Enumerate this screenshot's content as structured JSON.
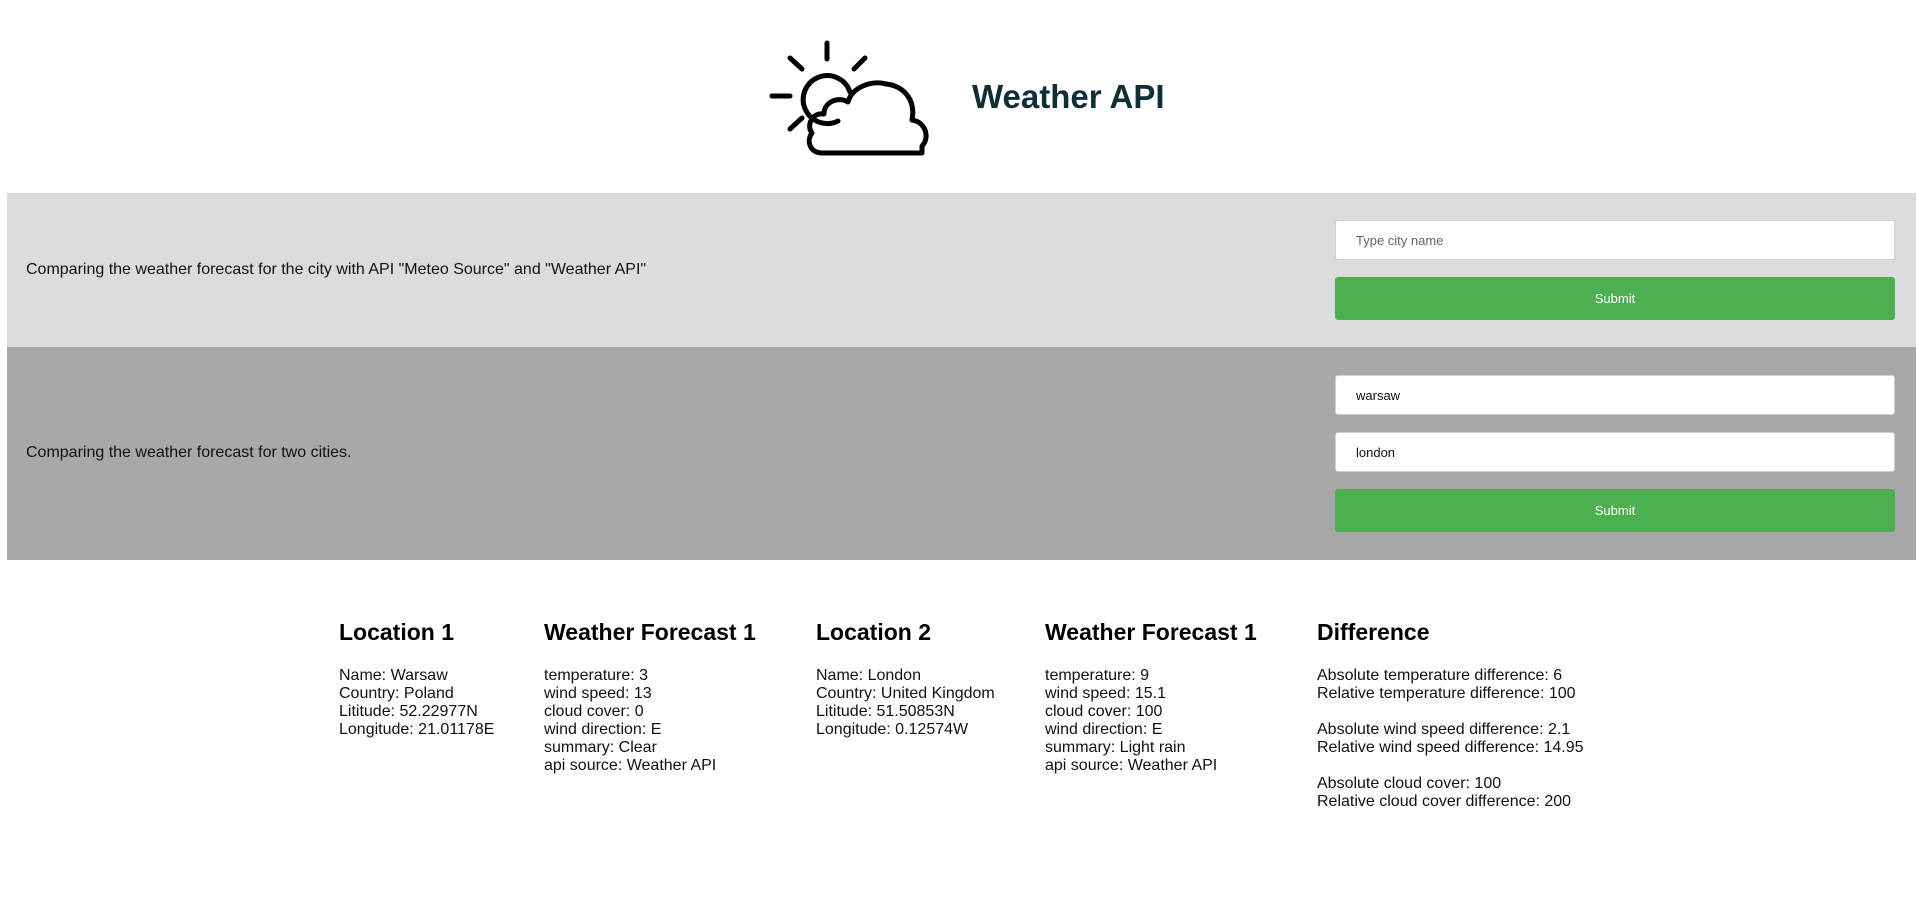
{
  "header": {
    "title": "Weather API",
    "logo_icon": "sun-cloud-icon"
  },
  "compare_api": {
    "description": "Comparing the weather forecast for the city with API \"Meteo Source\" and \"Weather API\"",
    "city_input": {
      "value": "",
      "placeholder": "Type city name"
    },
    "submit_label": "Submit"
  },
  "compare_cities": {
    "description": "Comparing the weather forecast for two cities.",
    "city1_input": {
      "value": "warsaw",
      "placeholder": ""
    },
    "city2_input": {
      "value": "london",
      "placeholder": ""
    },
    "submit_label": "Submit"
  },
  "colors": {
    "title": "#0f2e35",
    "section1_bg": "#dcdcdc",
    "section2_bg": "#a8a8a8",
    "button": "#4caf50"
  },
  "results": {
    "location1": {
      "heading": "Location 1",
      "lines": [
        "Name: Warsaw",
        "Country: Poland",
        "Lititude: 52.22977N",
        "Longitude: 21.01178E"
      ]
    },
    "forecast1": {
      "heading": "Weather Forecast 1",
      "lines": [
        "temperature: 3",
        "wind speed: 13",
        "cloud cover: 0",
        "wind direction: E",
        "summary: Clear",
        "api source: Weather API"
      ]
    },
    "location2": {
      "heading": "Location 2",
      "lines": [
        "Name: London",
        "Country: United Kingdom",
        "Lititude: 51.50853N",
        "Longitude: 0.12574W"
      ]
    },
    "forecast2": {
      "heading": "Weather Forecast 1",
      "lines": [
        "temperature: 9",
        "wind speed: 15.1",
        "cloud cover: 100",
        "wind direction: E",
        "summary: Light rain",
        "api source: Weather API"
      ]
    },
    "difference": {
      "heading": "Difference",
      "lines": [
        "Absolute temperature difference: 6",
        "Relative temperature difference: 100",
        "Absolute wind speed difference: 2.1",
        "Relative wind speed difference: 14.95",
        "Absolute cloud cover: 100",
        "Relative cloud cover difference: 200"
      ]
    }
  }
}
